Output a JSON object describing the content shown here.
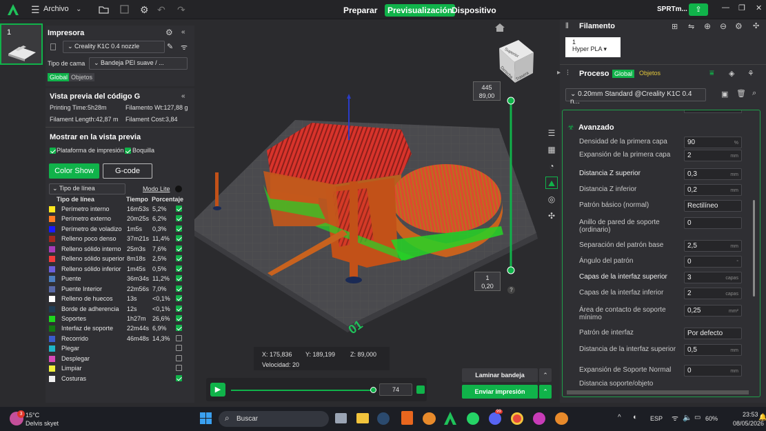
{
  "topbar": {
    "file_menu": "Archivo",
    "tabs": [
      "Preparar",
      "Previsualización",
      "Dispositivo"
    ],
    "active_tab": "Previsualización",
    "brand": "SPRTm..."
  },
  "plate": {
    "number": "1"
  },
  "printer": {
    "title": "Impresora",
    "name": "Creality K1C 0.4 nozzle",
    "bed_type_label": "Tipo de cama",
    "bed_type_value": "Bandeja PEI suave / ...",
    "global": "Global",
    "objects": "Objetos"
  },
  "gcode": {
    "title": "Vista previa del código G",
    "printing_time": "Printing Time:5h28m",
    "filament_wt": "Filamento Wt:127,88 g",
    "filament_length": "Filament Length:42,87 m",
    "filament_cost": "Filament Cost:3,84",
    "show_title": "Mostrar en la vista previa",
    "opt1": "Plataforma de impresión",
    "opt2": "Boquilla",
    "color_show": "Color Show",
    "gcode_btn": "G-code",
    "line_type_select": "Tipo de línea",
    "lite_mode": "Modo Lite",
    "col_type": "Tipo de línea",
    "col_time": "Tiempo",
    "col_pct": "Porcentaje",
    "rows": [
      {
        "name": "Perímetro interno",
        "time": "16m53s",
        "pct": "5,2%",
        "color": "#ffe81f",
        "on": true
      },
      {
        "name": "Perímetro externo",
        "time": "20m25s",
        "pct": "6,2%",
        "color": "#ff7b23",
        "on": true
      },
      {
        "name": "Perímetro de voladizo",
        "time": "1m5s",
        "pct": "0,3%",
        "color": "#1a1aff",
        "on": true
      },
      {
        "name": "Relleno poco denso",
        "time": "37m21s",
        "pct": "11,4%",
        "color": "#a3281e",
        "on": true
      },
      {
        "name": "Relleno sólido interno",
        "time": "25m3s",
        "pct": "7,6%",
        "color": "#a63cb8",
        "on": true
      },
      {
        "name": "Relleno sólido superior",
        "time": "8m18s",
        "pct": "2,5%",
        "color": "#f03c3c",
        "on": true
      },
      {
        "name": "Relleno sólido inferior",
        "time": "1m45s",
        "pct": "0,5%",
        "color": "#6b5fdb",
        "on": true
      },
      {
        "name": "Puente",
        "time": "36m34s",
        "pct": "11,2%",
        "color": "#4d7fbf",
        "on": true
      },
      {
        "name": "Puente Interior",
        "time": "22m56s",
        "pct": "7,0%",
        "color": "#5a6aa8",
        "on": true
      },
      {
        "name": "Relleno de huecos",
        "time": "13s",
        "pct": "<0,1%",
        "color": "#ffffff",
        "on": true
      },
      {
        "name": "Borde de adherencia",
        "time": "12s",
        "pct": "<0,1%",
        "color": "#1f3d55",
        "on": true
      },
      {
        "name": "Soportes",
        "time": "1h27m",
        "pct": "26,6%",
        "color": "#1fd61f",
        "on": true
      },
      {
        "name": "Interfaz de soporte",
        "time": "22m44s",
        "pct": "6,9%",
        "color": "#127a12",
        "on": true
      },
      {
        "name": "Recorrido",
        "time": "46m48s",
        "pct": "14,3%",
        "color": "#3a5ccc",
        "on": false
      },
      {
        "name": "Plegar",
        "time": "",
        "pct": "",
        "color": "#1fb6c8",
        "on": false
      },
      {
        "name": "Desplegar",
        "time": "",
        "pct": "",
        "color": "#d64ab8",
        "on": false
      },
      {
        "name": "Limpiar",
        "time": "",
        "pct": "",
        "color": "#f0f03c",
        "on": false
      },
      {
        "name": "Costuras",
        "time": "",
        "pct": "",
        "color": "#f0f0f0",
        "on": true
      }
    ]
  },
  "viewport": {
    "layer_top_a": "445",
    "layer_top_b": "89,00",
    "layer_bot_a": "1",
    "layer_bot_b": "0,20",
    "help": "?",
    "cube_top": "Superior",
    "cube_front": "Derecha",
    "cube_side": "Trasera",
    "coord_x": "X: 175,836",
    "coord_y": "Y: 189,199",
    "coord_z": "Z: 89,000",
    "speed": "Velocidad: 20",
    "move_value": "74",
    "slice_btn": "Laminar bandeja",
    "send_btn": "Enviar impresión"
  },
  "filament": {
    "title": "Filamento",
    "slot": "1",
    "type": "Hyper PLA"
  },
  "process": {
    "title": "Proceso",
    "global": "Global",
    "objects": "Objetos",
    "preset": "0.20mm Standard @Creality K1C 0.4 n...",
    "section": "Avanzado",
    "params": [
      {
        "label": "Densidad de la primera capa",
        "value": "90",
        "unit": "%",
        "hi": false
      },
      {
        "label": "Expansión de la primera capa",
        "value": "2",
        "unit": "mm",
        "hi": false
      },
      {
        "label": "Distancia Z superior",
        "value": "0,3",
        "unit": "mm",
        "hi": true
      },
      {
        "label": "Distancia Z inferior",
        "value": "0,2",
        "unit": "mm",
        "hi": false
      },
      {
        "label": "Patrón básico (normal)",
        "value": "Rectilíneo",
        "unit": "",
        "hi": false
      },
      {
        "label": "Anillo de pared de soporte (ordinario)",
        "value": "0",
        "unit": "",
        "hi": false
      },
      {
        "label": "Separación del patrón base",
        "value": "2,5",
        "unit": "mm",
        "hi": false
      },
      {
        "label": "Ángulo del patrón",
        "value": "0",
        "unit": "°",
        "hi": false
      },
      {
        "label": "Capas de la interfaz superior",
        "value": "3",
        "unit": "capas",
        "hi": true
      },
      {
        "label": "Capas de la interfaz inferior",
        "value": "2",
        "unit": "capas",
        "hi": false
      },
      {
        "label": "Área de contacto de soporte mínimo",
        "value": "0,25",
        "unit": "mm²",
        "hi": false
      },
      {
        "label": "Patrón de interfaz",
        "value": "Por defecto",
        "unit": "",
        "hi": false
      },
      {
        "label": "Distancia de la interfaz superior",
        "value": "0,5",
        "unit": "mm",
        "hi": false
      },
      {
        "label": "Expansión de Soporte Normal",
        "value": "0",
        "unit": "mm",
        "hi": false
      },
      {
        "label": "Distancia soporte/objeto",
        "value": "",
        "unit": "",
        "hi": false
      }
    ]
  },
  "taskbar": {
    "temp": "15°C",
    "weather": "Delvis skyet",
    "search": "Buscar",
    "lang": "ESP",
    "battery": "60%",
    "time": "23:53",
    "date": "08/05/2026",
    "notif": "3",
    "badge": "99"
  }
}
